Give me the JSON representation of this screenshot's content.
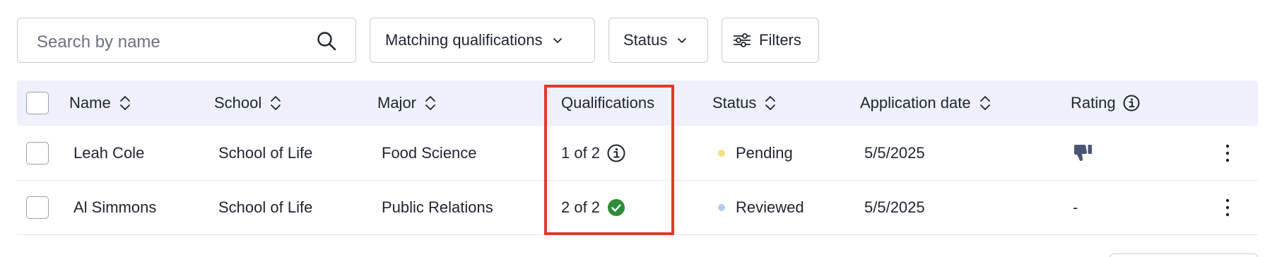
{
  "toolbar": {
    "search_placeholder": "Search by name",
    "matching_label": "Matching qualifications",
    "status_label": "Status",
    "filters_label": "Filters"
  },
  "table": {
    "columns": [
      "Name",
      "School",
      "Major",
      "Qualifications",
      "Status",
      "Application date",
      "Rating"
    ],
    "rows": [
      {
        "name": "Leah Cole",
        "school": "School of Life",
        "major": "Food Science",
        "qualifications": "1 of 2",
        "qualifications_icon": "info-icon",
        "status": "Pending",
        "status_color": "#f3e27a",
        "date": "5/5/2025",
        "rating_icon": "thumbs-down-icon"
      },
      {
        "name": "Al Simmons",
        "school": "School of Life",
        "major": "Public Relations",
        "qualifications": "2 of 2",
        "qualifications_icon": "check-circle-icon",
        "status": "Reviewed",
        "status_color": "#b9c9f2",
        "date": "5/5/2025",
        "rating": "-"
      }
    ]
  },
  "colors": {
    "header_bg": "#eef1fb",
    "highlight": "#e0392b",
    "check_green": "#2e8b3a",
    "rating_icon": "#4a5572"
  }
}
